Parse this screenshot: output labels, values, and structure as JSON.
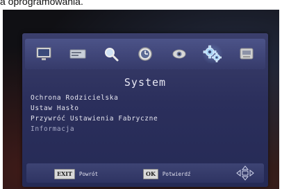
{
  "caption": {
    "text": "a oprogramowania."
  },
  "tabs": [
    {
      "icon": "picture-icon",
      "active": false
    },
    {
      "icon": "channel-list-icon",
      "active": false
    },
    {
      "icon": "search-icon",
      "active": false
    },
    {
      "icon": "clock-icon",
      "active": false
    },
    {
      "icon": "eye-icon",
      "active": false
    },
    {
      "icon": "gears-icon",
      "active": true
    },
    {
      "icon": "usb-icon",
      "active": false
    }
  ],
  "menu": {
    "title": "System",
    "items": [
      {
        "label": "Ochrona Rodzicielska"
      },
      {
        "label": "Ustaw Hasło"
      },
      {
        "label": "Przywróć Ustawienia Fabryczne"
      },
      {
        "label": "Informacja"
      }
    ]
  },
  "footer": {
    "exit_key": "EXIT",
    "exit_label": "Powrót",
    "ok_key": "OK",
    "ok_label": "Potwierdź",
    "nav_icon": "dpad-navigation-icon"
  },
  "colors": {
    "osd_background": "#2b2f5c",
    "text": "#e6e6f0",
    "active_tab_glow": "#96c8ff"
  }
}
